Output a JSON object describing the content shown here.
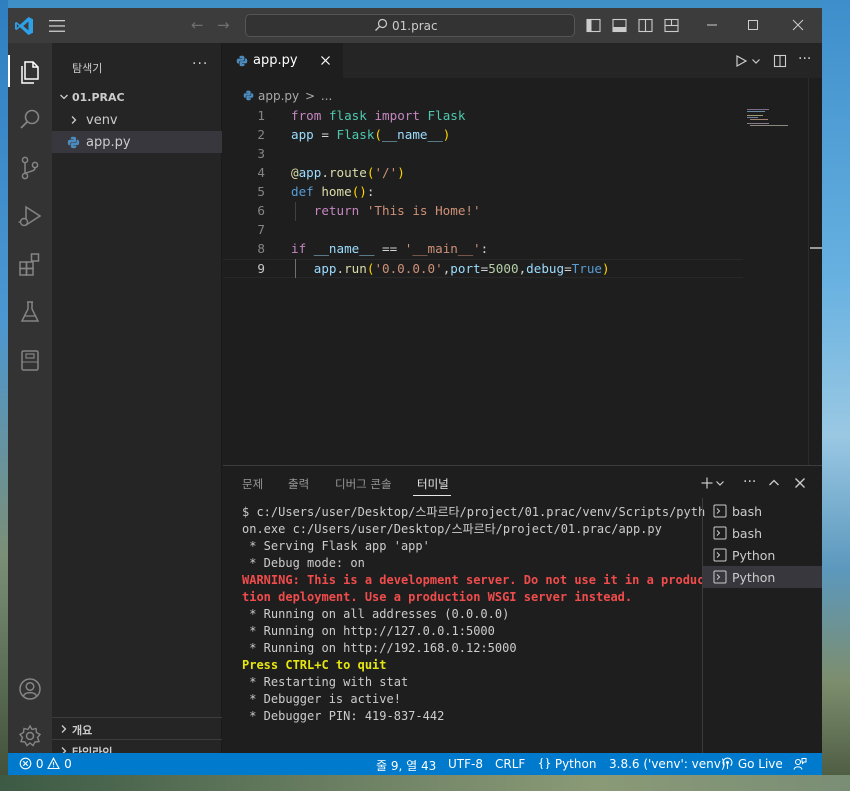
{
  "titlebar": {
    "search_text": "01.prac"
  },
  "sidebar": {
    "header": "탐색기",
    "more": "···",
    "folder_name": "01.PRAC",
    "items": [
      {
        "label": "venv",
        "type": "folder"
      },
      {
        "label": "app.py",
        "type": "file",
        "selected": true
      }
    ],
    "outline_label": "개요",
    "timeline_label": "타임라인"
  },
  "editor": {
    "tab_label": "app.py",
    "breadcrumb_file": "app.py",
    "breadcrumb_sep": ">",
    "breadcrumb_more": "...",
    "line_numbers": [
      "1",
      "2",
      "3",
      "4",
      "5",
      "6",
      "7",
      "8",
      "9"
    ],
    "active_line": 9
  },
  "panel": {
    "tabs": [
      "문제",
      "출력",
      "디버그 콘솔",
      "터미널"
    ],
    "active_tab": "터미널",
    "terminal_lines": [
      "$ c:/Users/user/Desktop/스파르타/project/01.prac/venv/Scripts/python.exe c:/Users/user/Desktop/스파르타/project/01.prac/app.py",
      " * Serving Flask app 'app'",
      " * Debug mode: on",
      "WARNING: This is a development server. Do not use it in a production deployment. Use a production WSGI server instead.",
      " * Running on all addresses (0.0.0.0)",
      " * Running on http://127.0.0.1:5000",
      " * Running on http://192.168.0.12:5000",
      "Press CTRL+C to quit",
      " * Restarting with stat",
      " * Debugger is active!",
      " * Debugger PIN: 419-837-442"
    ],
    "terminals": [
      "bash",
      "bash",
      "Python",
      "Python"
    ]
  },
  "statusbar": {
    "errors": "0",
    "warnings": "0",
    "position": "줄 9, 열 43",
    "encoding": "UTF-8",
    "eol": "CRLF",
    "language": "Python",
    "interpreter": "3.8.6 ('venv': venv)",
    "golive": "Go Live"
  },
  "colors": {
    "accent": "#007acc",
    "activity_bar": "#333333",
    "sidebar": "#252526",
    "editor": "#1e1e1e",
    "titlebar": "#3c3c3c",
    "warning_red": "#f14c4c",
    "press_yellow": "#e5e510"
  },
  "icons": {
    "activity": [
      "explorer-icon",
      "search-icon",
      "source-control-icon",
      "run-debug-icon",
      "extensions-icon",
      "testing-icon",
      "notebook-icon",
      "account-icon",
      "settings-gear-icon"
    ]
  }
}
